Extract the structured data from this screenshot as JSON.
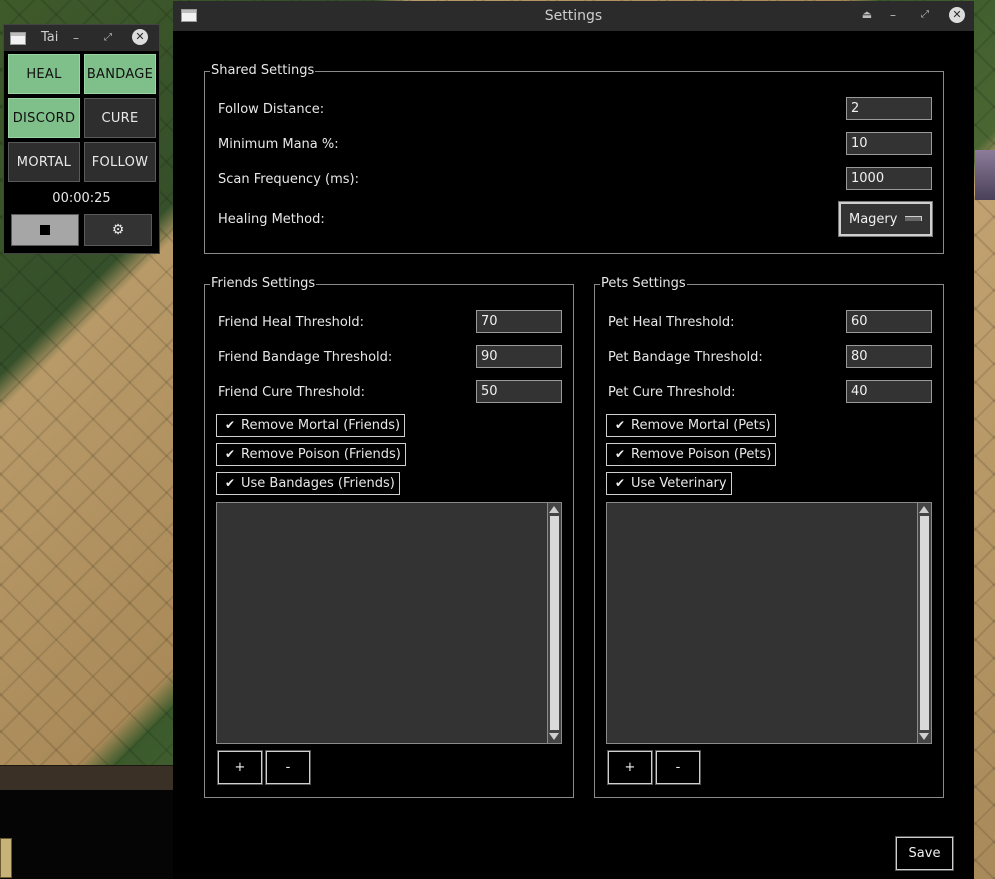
{
  "mini_window": {
    "title": "Tai",
    "buttons": [
      {
        "label": "HEAL",
        "active": true
      },
      {
        "label": "BANDAGE",
        "active": true
      },
      {
        "label": "DISCORD",
        "active": true
      },
      {
        "label": "CURE",
        "active": false
      },
      {
        "label": "MORTAL",
        "active": false
      },
      {
        "label": "FOLLOW",
        "active": false
      }
    ],
    "timer": "00:00:25",
    "stop_icon": "stop-square-icon",
    "settings_icon_glyph": "⚙"
  },
  "settings": {
    "title": "Settings",
    "shared": {
      "legend": "Shared Settings",
      "follow_distance_label": "Follow Distance:",
      "follow_distance_value": "2",
      "min_mana_label": "Minimum Mana %:",
      "min_mana_value": "10",
      "scan_freq_label": "Scan Frequency (ms):",
      "scan_freq_value": "1000",
      "healing_method_label": "Healing Method:",
      "healing_method_value": "Magery"
    },
    "friends": {
      "legend": "Friends Settings",
      "heal_label": "Friend Heal Threshold:",
      "heal_value": "70",
      "bandage_label": "Friend Bandage Threshold:",
      "bandage_value": "90",
      "cure_label": "Friend Cure Threshold:",
      "cure_value": "50",
      "checkboxes": [
        {
          "label": "Remove Mortal (Friends)",
          "checked": true
        },
        {
          "label": "Remove Poison (Friends)",
          "checked": true
        },
        {
          "label": "Use Bandages (Friends)",
          "checked": true
        }
      ],
      "add_label": "+",
      "remove_label": "-"
    },
    "pets": {
      "legend": "Pets Settings",
      "heal_label": "Pet Heal Threshold:",
      "heal_value": "60",
      "bandage_label": "Pet Bandage Threshold:",
      "bandage_value": "80",
      "cure_label": "Pet Cure Threshold:",
      "cure_value": "40",
      "checkboxes": [
        {
          "label": "Remove Mortal (Pets)",
          "checked": true
        },
        {
          "label": "Remove Poison (Pets)",
          "checked": true
        },
        {
          "label": "Use Veterinary",
          "checked": true
        }
      ],
      "add_label": "+",
      "remove_label": "-"
    },
    "save_label": "Save"
  },
  "colors": {
    "active_button": "#7fbf8a",
    "window_bg": "#000000",
    "input_bg": "#333333"
  }
}
